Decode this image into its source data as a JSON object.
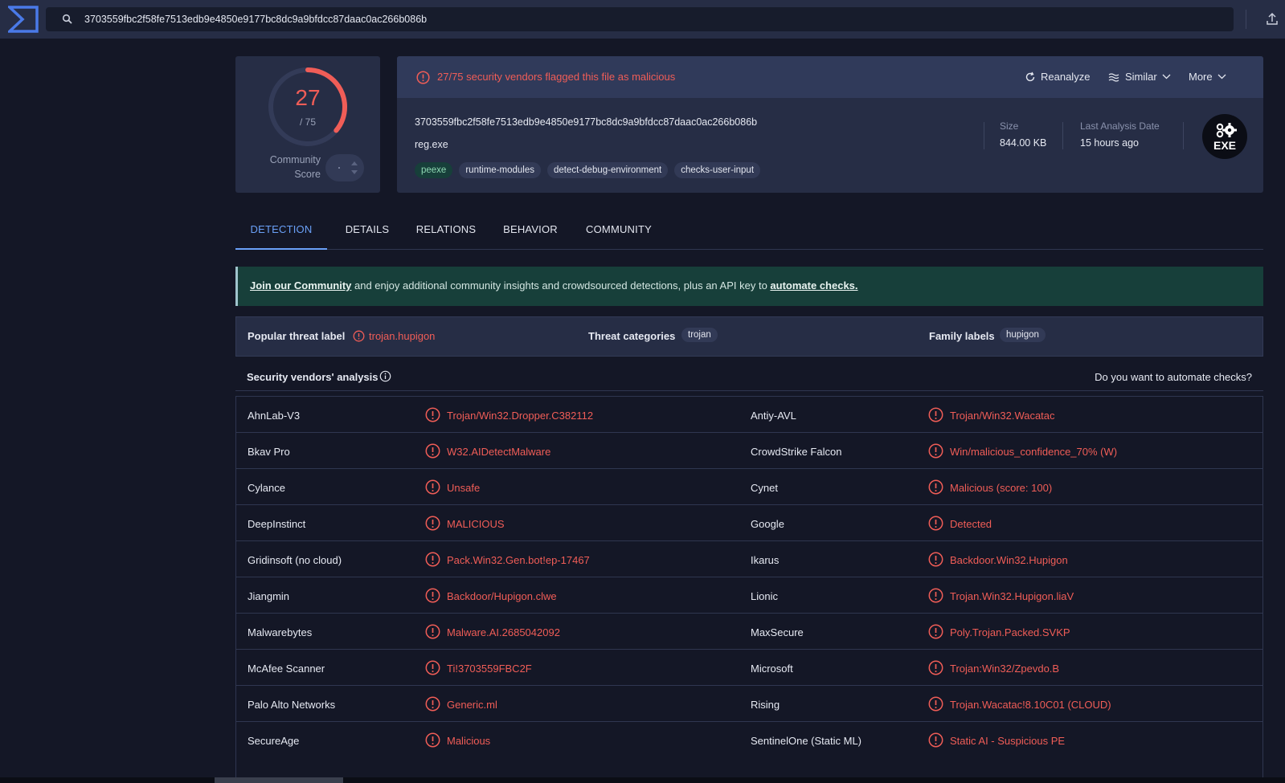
{
  "search": {
    "value": "3703559fbc2f58fe7513edb9e4850e9177bc8dc9a9bfdcc87daac0ac266b086b"
  },
  "score": {
    "detections": "27",
    "total": "/ 75",
    "community_label_1": "Community",
    "community_label_2": "Score",
    "fraction": 0.36
  },
  "alert": {
    "text": "27/75 security vendors flagged this file as malicious"
  },
  "actions": {
    "reanalyze": "Reanalyze",
    "similar": "Similar",
    "more": "More"
  },
  "file": {
    "hash": "3703559fbc2f58fe7513edb9e4850e9177bc8dc9a9bfdcc87daac0ac266b086b",
    "name": "reg.exe",
    "tags": [
      "peexe",
      "runtime-modules",
      "detect-debug-environment",
      "checks-user-input"
    ],
    "size_label": "Size",
    "size_value": "844.00 KB",
    "date_label": "Last Analysis Date",
    "date_value": "15 hours ago",
    "type_icon_text": "EXE"
  },
  "tabs": [
    "DETECTION",
    "DETAILS",
    "RELATIONS",
    "BEHAVIOR",
    "COMMUNITY"
  ],
  "banner": {
    "link1": "Join our Community",
    "mid": " and enjoy additional community insights and crowdsourced detections, plus an API key to ",
    "link2": "automate checks."
  },
  "threat": {
    "popular_label": "Popular threat label",
    "popular_value": "trojan.hupigon",
    "categories_label": "Threat categories",
    "categories_value": "trojan",
    "family_label": "Family labels",
    "family_value": "hupigon"
  },
  "vendors_header": {
    "title": "Security vendors' analysis",
    "automate": "Do you want to automate checks?"
  },
  "vendors": [
    [
      [
        "AhnLab-V3",
        "Trojan/Win32.Dropper.C382112"
      ],
      [
        "Antiy-AVL",
        "Trojan/Win32.Wacatac"
      ]
    ],
    [
      [
        "Bkav Pro",
        "W32.AIDetectMalware"
      ],
      [
        "CrowdStrike Falcon",
        "Win/malicious_confidence_70% (W)"
      ]
    ],
    [
      [
        "Cylance",
        "Unsafe"
      ],
      [
        "Cynet",
        "Malicious (score: 100)"
      ]
    ],
    [
      [
        "DeepInstinct",
        "MALICIOUS"
      ],
      [
        "Google",
        "Detected"
      ]
    ],
    [
      [
        "Gridinsoft (no cloud)",
        "Pack.Win32.Gen.bot!ep-17467"
      ],
      [
        "Ikarus",
        "Backdoor.Win32.Hupigon"
      ]
    ],
    [
      [
        "Jiangmin",
        "Backdoor/Hupigon.clwe"
      ],
      [
        "Lionic",
        "Trojan.Win32.Hupigon.liaV"
      ]
    ],
    [
      [
        "Malwarebytes",
        "Malware.AI.2685042092"
      ],
      [
        "MaxSecure",
        "Poly.Trojan.Packed.SVKP"
      ]
    ],
    [
      [
        "McAfee Scanner",
        "Ti!3703559FBC2F"
      ],
      [
        "Microsoft",
        "Trojan:Win32/Zpevdo.B"
      ]
    ],
    [
      [
        "Palo Alto Networks",
        "Generic.ml"
      ],
      [
        "Rising",
        "Trojan.Wacatac!8.10C01 (CLOUD)"
      ]
    ],
    [
      [
        "SecureAge",
        "Malicious"
      ],
      [
        "SentinelOne (Static ML)",
        "Static AI - Suspicious PE"
      ]
    ]
  ],
  "colors": {
    "malicious": "#f05d57",
    "accent": "#6aa0f7",
    "banner": "#173f3a"
  },
  "icons": [
    "logo-icon",
    "search-icon",
    "upload-icon",
    "alert-circle-icon",
    "refresh-icon",
    "similar-icon",
    "chevron-down-icon",
    "exe-file-icon",
    "info-icon"
  ]
}
